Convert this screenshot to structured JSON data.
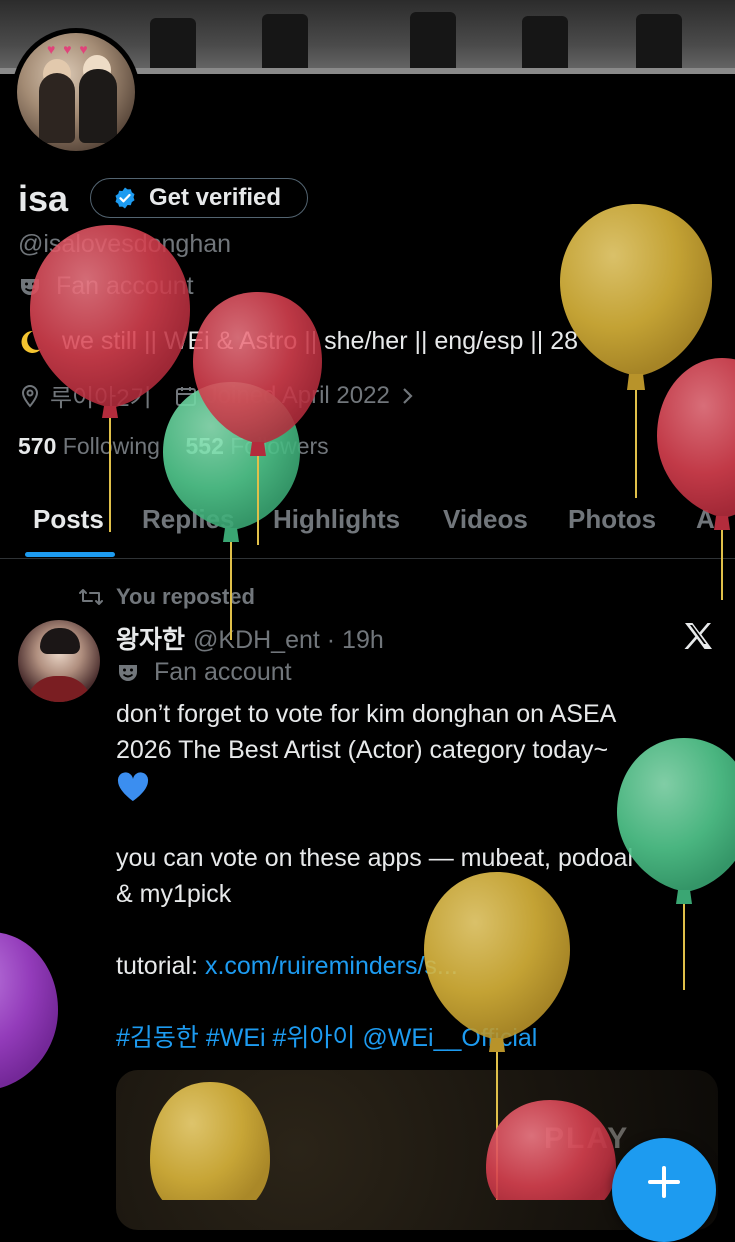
{
  "profile": {
    "name": "isa",
    "verify_label": "Get verified",
    "handle": "@isalovesdonghan",
    "category": "Fan account",
    "bio": "we still || WEi & Astro || she/her || eng/esp || 28",
    "location": "루이아2기",
    "joined": "Joined April 2022",
    "following_count": "570",
    "following_label": "Following",
    "followers_count": "552",
    "followers_label": "Followers"
  },
  "tabs": [
    {
      "label": "Posts",
      "active": true
    },
    {
      "label": "Replies"
    },
    {
      "label": "Highlights"
    },
    {
      "label": "Videos"
    },
    {
      "label": "Photos"
    },
    {
      "label": "A"
    }
  ],
  "post": {
    "repost_label": "You reposted",
    "display_name": "왕자한",
    "handle_time": "@KDH_ent · 19h",
    "category": "Fan account",
    "text_line1": "don’t forget to vote for kim donghan on ASEA",
    "text_line2": "2026 The Best Artist (Actor) category today~",
    "text_line4": "you can vote on these apps — mubeat, podoal",
    "text_line5": "& my1pick",
    "tutorial_label": "tutorial: ",
    "tutorial_link": "x.com/ruireminders/s...",
    "hashtags": "#김동한 #WEi #위아이 @WEi__Official",
    "media_label": "PLAY"
  },
  "icons": {
    "verified": "verified-badge-icon",
    "fan": "theater-mask-icon",
    "moon": "crescent-moon-icon",
    "location": "location-pin-icon",
    "calendar": "calendar-icon",
    "repost": "repost-icon",
    "x": "x-logo-icon",
    "compose": "plus-icon"
  },
  "colors": {
    "accent": "#1d9bf0",
    "muted": "#71767b",
    "balloon_red": "#d7404f",
    "balloon_yellow": "#d9b43a",
    "balloon_green": "#52c98e",
    "balloon_purple": "#9b3fc4"
  }
}
